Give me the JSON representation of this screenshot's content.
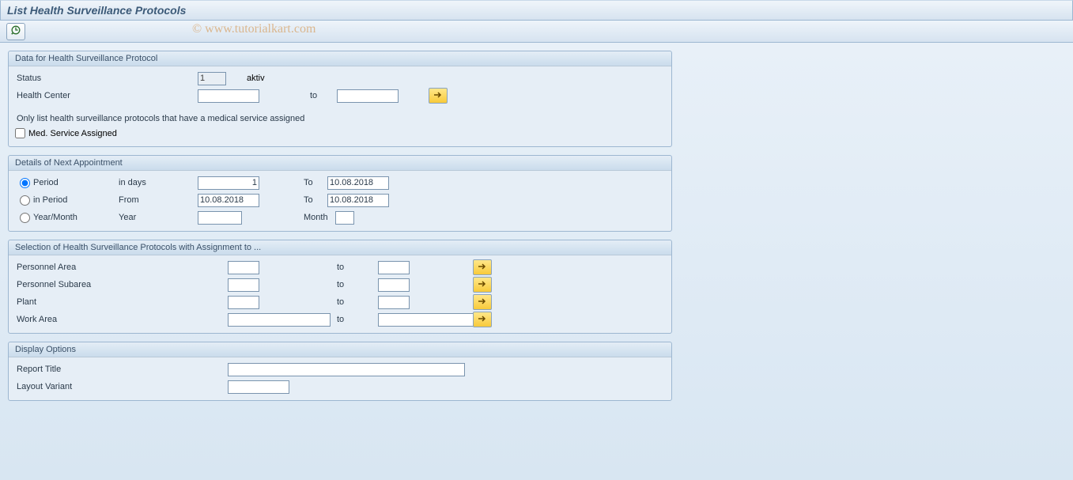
{
  "title": "List Health Surveillance Protocols",
  "watermark": "© www.tutorialkart.com",
  "group1": {
    "title": "Data for Health Surveillance Protocol",
    "status_label": "Status",
    "status_value": "1",
    "status_text": "aktiv",
    "health_center_label": "Health Center",
    "to_label": "to",
    "note": "Only list health surveillance protocols that have a medical service assigned",
    "med_service_label": "Med. Service Assigned",
    "med_service_checked": false
  },
  "group2": {
    "title": "Details of Next Appointment",
    "opt_period": "Period",
    "opt_in_period": "in Period",
    "opt_year_month": "Year/Month",
    "selected": "period",
    "in_days_label": "in days",
    "days_value": "1",
    "to_label": "To",
    "to_date1": "10.08.2018",
    "from_label": "From",
    "from_date": "10.08.2018",
    "to_date2": "10.08.2018",
    "year_label": "Year",
    "year_value": "",
    "month_label": "Month",
    "month_value": ""
  },
  "group3": {
    "title": "Selection of Health Surveillance Protocols with Assignment to ...",
    "personnel_area": "Personnel Area",
    "personnel_subarea": "Personnel Subarea",
    "plant": "Plant",
    "work_area": "Work Area",
    "to_label": "to"
  },
  "group4": {
    "title": "Display Options",
    "report_title": "Report Title",
    "layout_variant": "Layout Variant"
  }
}
